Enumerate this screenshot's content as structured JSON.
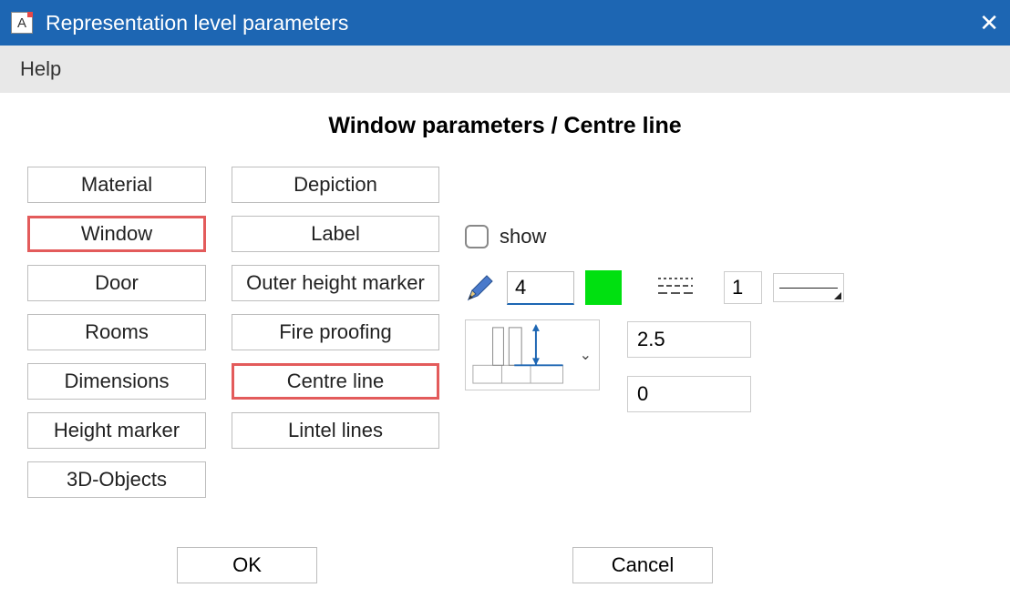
{
  "window": {
    "title": "Representation level parameters",
    "app_icon_letter": "A"
  },
  "menubar": {
    "help": "Help"
  },
  "page_title": "Window parameters / Centre line",
  "left_tabs": [
    {
      "label": "Material",
      "highlighted": false
    },
    {
      "label": "Window",
      "highlighted": true
    },
    {
      "label": "Door",
      "highlighted": false
    },
    {
      "label": "Rooms",
      "highlighted": false
    },
    {
      "label": "Dimensions",
      "highlighted": false
    },
    {
      "label": "Height marker",
      "highlighted": false
    },
    {
      "label": "3D-Objects",
      "highlighted": false
    }
  ],
  "sub_tabs": [
    {
      "label": "Depiction",
      "highlighted": false
    },
    {
      "label": "Label",
      "highlighted": false
    },
    {
      "label": "Outer height marker",
      "highlighted": false
    },
    {
      "label": "Fire proofing",
      "highlighted": false
    },
    {
      "label": "Centre line",
      "highlighted": true
    },
    {
      "label": "Lintel lines",
      "highlighted": false
    }
  ],
  "show": {
    "label": "show",
    "checked": false
  },
  "pen": {
    "color_index": "4",
    "swatch_color": "#00e010"
  },
  "line": {
    "weight": "1"
  },
  "values": {
    "a": "2.5",
    "b": "0"
  },
  "footer": {
    "ok": "OK",
    "cancel": "Cancel"
  }
}
